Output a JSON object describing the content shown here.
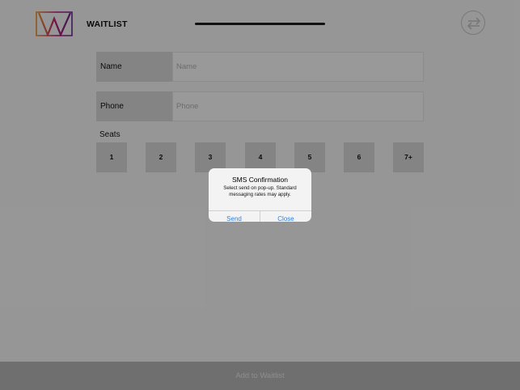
{
  "header": {
    "logo_icon": "w-logo-icon",
    "title": "WAITLIST",
    "swap_icon": "swap-arrows-icon"
  },
  "form": {
    "name": {
      "label": "Name",
      "placeholder": "Name",
      "value": ""
    },
    "phone": {
      "label": "Phone",
      "placeholder": "Phone",
      "value": ""
    },
    "seats_label": "Seats",
    "seats": [
      "1",
      "2",
      "3",
      "4",
      "5",
      "6",
      "7+"
    ]
  },
  "footer": {
    "button_label": "Add to Waitlist"
  },
  "dialog": {
    "title": "SMS Confirmation",
    "message": "Select send on pop-up. Standard messaging rates may apply.",
    "send_label": "Send",
    "close_label": "Close"
  },
  "colors": {
    "accent_blue": "#2e7fe0",
    "logo_orange": "#f0912e",
    "logo_magenta": "#c2187a",
    "logo_purple": "#6a2c91"
  }
}
